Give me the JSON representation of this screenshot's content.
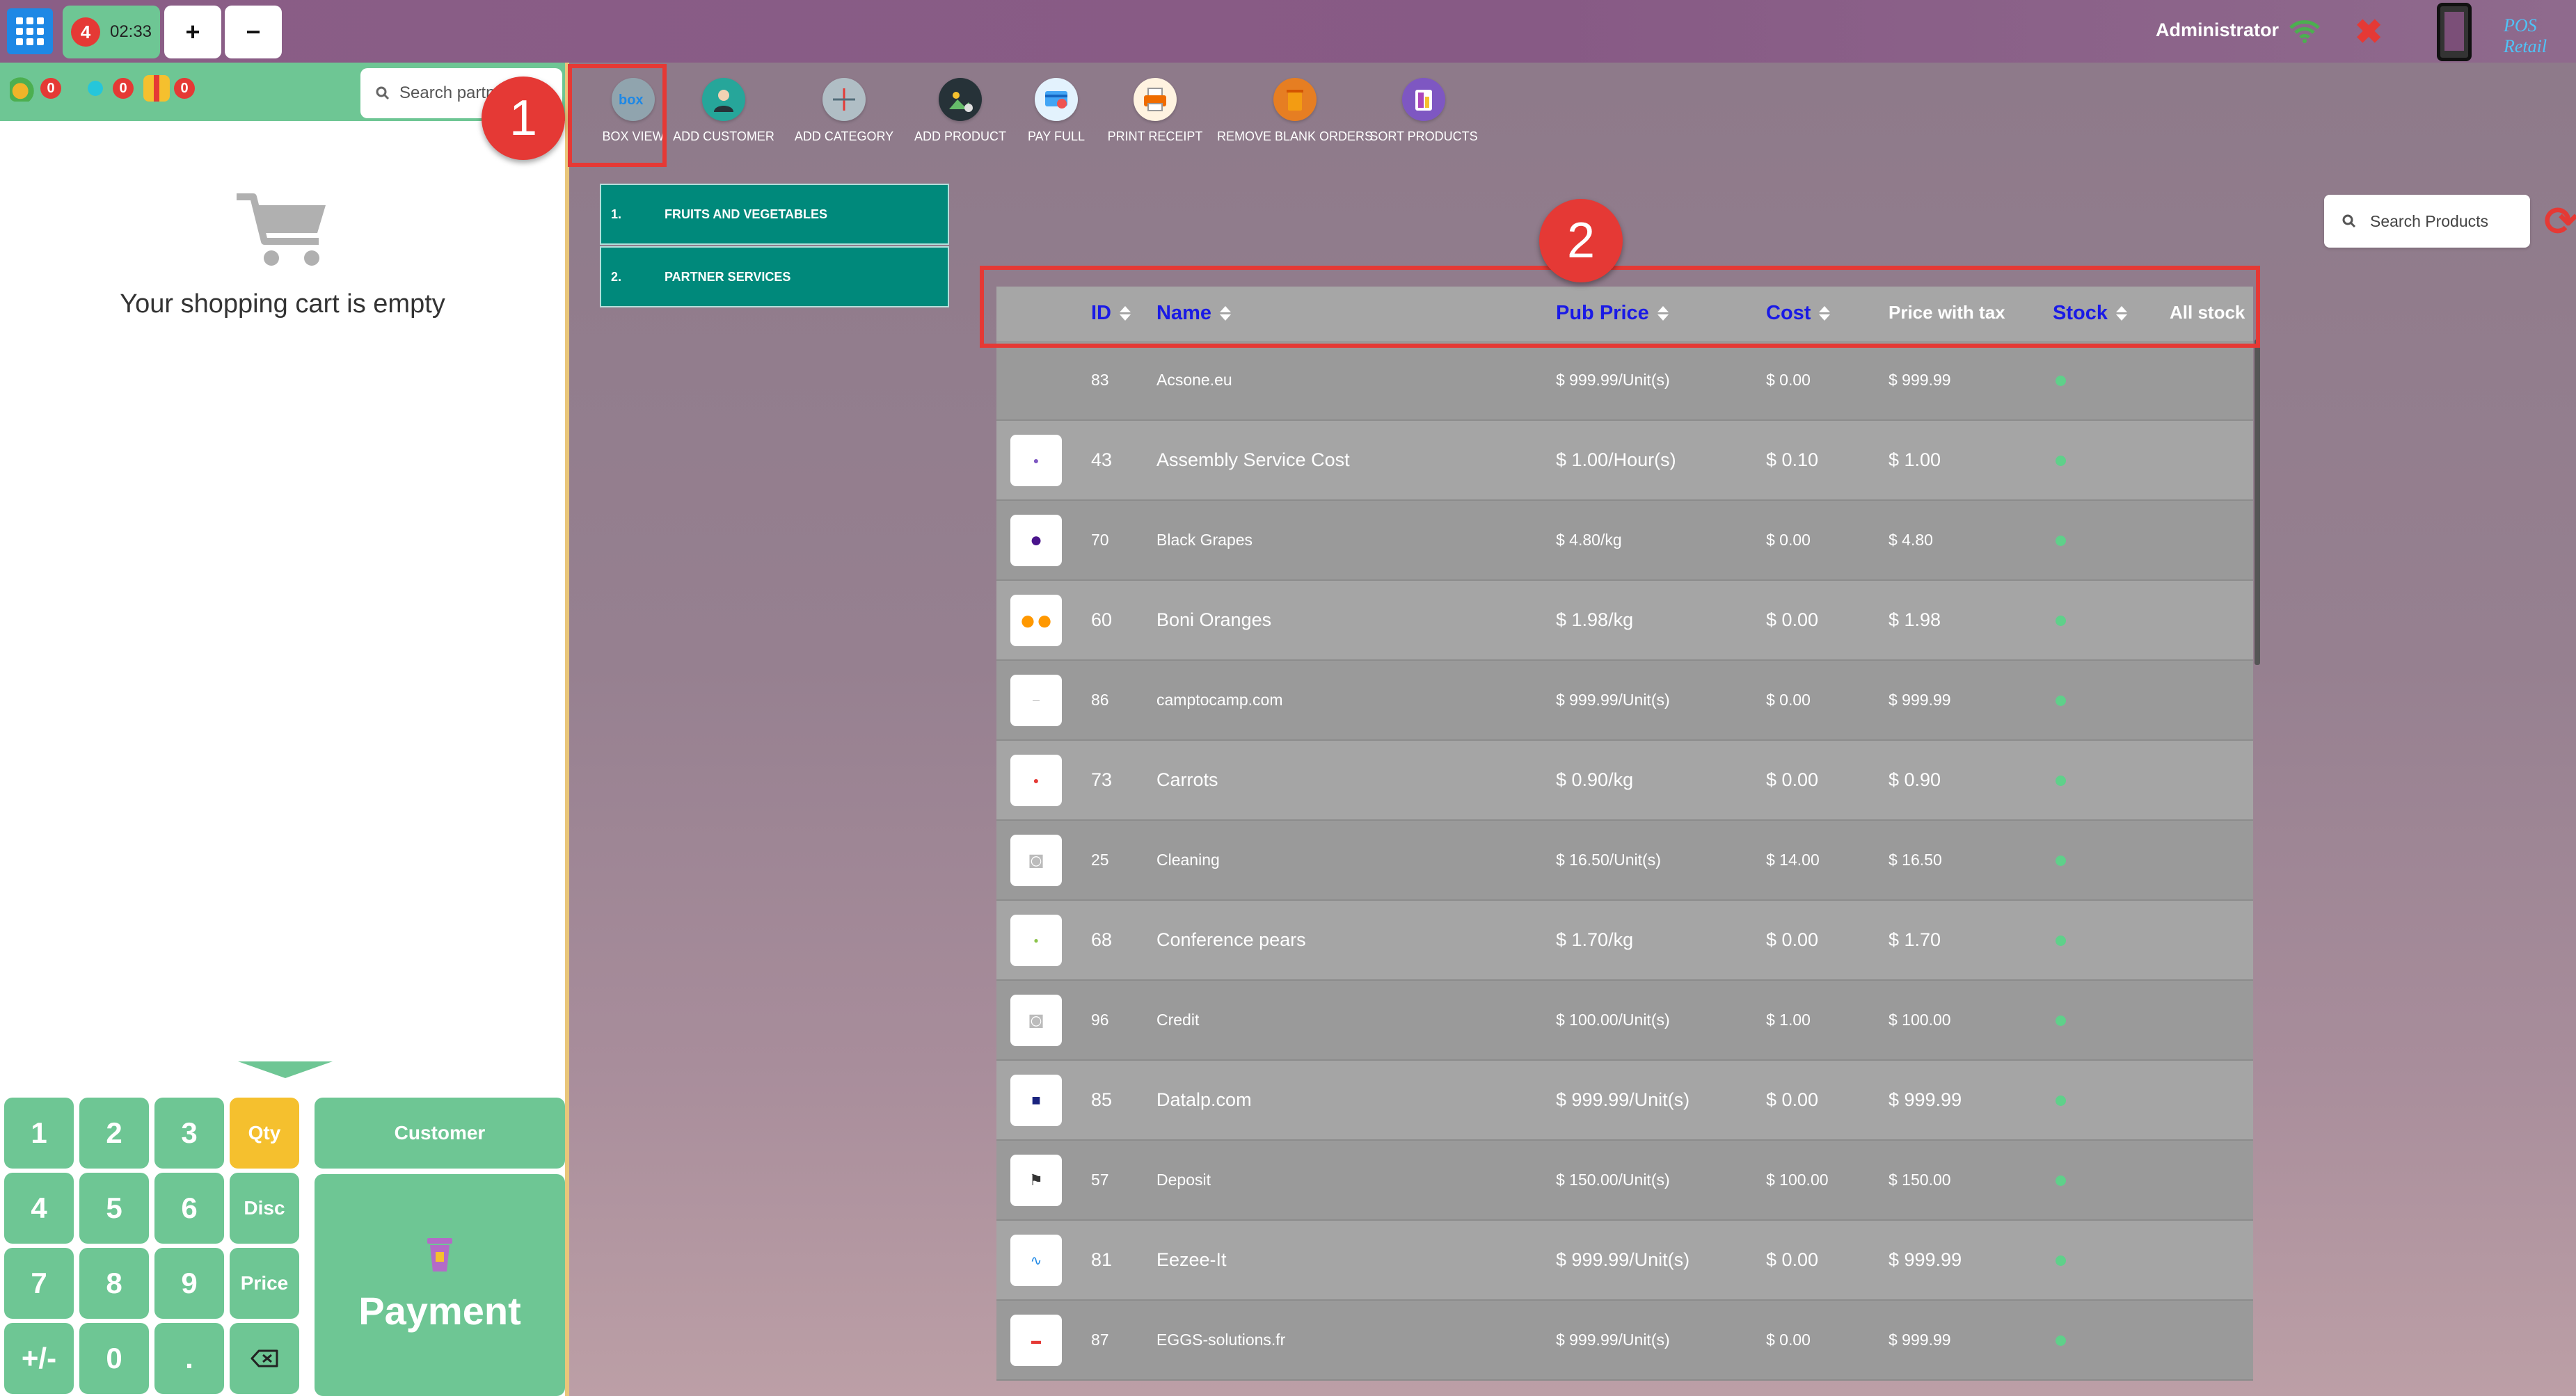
{
  "topbar": {
    "order_number": "4",
    "order_time": "02:33",
    "add_label": "+",
    "remove_label": "−",
    "user_name": "Administrator",
    "brand": "POS Retail"
  },
  "left": {
    "stats": [
      "0",
      "0",
      "0"
    ],
    "partner_search_placeholder": "Search partners",
    "cart_empty_text": "Your shopping cart is empty",
    "numpad": {
      "k1": "1",
      "k2": "2",
      "k3": "3",
      "k4": "4",
      "k5": "5",
      "k6": "6",
      "k7": "7",
      "k8": "8",
      "k9": "9",
      "k0": "0",
      "plusminus": "+/-",
      "dot": ".",
      "qty": "Qty",
      "disc": "Disc",
      "price": "Price"
    },
    "customer_label": "Customer",
    "payment_label": "Payment"
  },
  "toolbar": {
    "box_view": "BOX VIEW",
    "add_customer": "ADD CUSTOMER",
    "add_category": "ADD CATEGORY",
    "add_product": "ADD PRODUCT",
    "pay_full": "PAY FULL",
    "print_receipt": "PRINT RECEIPT",
    "remove_blank_orders": "REMOVE BLANK ORDERS",
    "sort_products": "SORT PRODUCTS"
  },
  "callouts": {
    "one": "1",
    "two": "2"
  },
  "categories": [
    {
      "index": "1.",
      "name": "FRUITS AND VEGETABLES"
    },
    {
      "index": "2.",
      "name": "PARTNER SERVICES"
    }
  ],
  "product_search_placeholder": "Search Products",
  "table": {
    "headers": {
      "id": "ID",
      "name": "Name",
      "pub_price": "Pub Price",
      "cost": "Cost",
      "price_with_tax": "Price with tax",
      "stock": "Stock",
      "all_stock": "All stock"
    },
    "rows": [
      {
        "id": "83",
        "name": "Acsone.eu",
        "pub_price": "$ 999.99/Unit(s)",
        "cost": "$ 0.00",
        "price_tax": "$ 999.99"
      },
      {
        "id": "43",
        "name": "Assembly Service Cost",
        "pub_price": "$ 1.00/Hour(s)",
        "cost": "$ 0.10",
        "price_tax": "$ 1.00"
      },
      {
        "id": "70",
        "name": "Black Grapes",
        "pub_price": "$ 4.80/kg",
        "cost": "$ 0.00",
        "price_tax": "$ 4.80"
      },
      {
        "id": "60",
        "name": "Boni Oranges",
        "pub_price": "$ 1.98/kg",
        "cost": "$ 0.00",
        "price_tax": "$ 1.98"
      },
      {
        "id": "86",
        "name": "camptocamp.com",
        "pub_price": "$ 999.99/Unit(s)",
        "cost": "$ 0.00",
        "price_tax": "$ 999.99"
      },
      {
        "id": "73",
        "name": "Carrots",
        "pub_price": "$ 0.90/kg",
        "cost": "$ 0.00",
        "price_tax": "$ 0.90"
      },
      {
        "id": "25",
        "name": "Cleaning",
        "pub_price": "$ 16.50/Unit(s)",
        "cost": "$ 14.00",
        "price_tax": "$ 16.50"
      },
      {
        "id": "68",
        "name": "Conference pears",
        "pub_price": "$ 1.70/kg",
        "cost": "$ 0.00",
        "price_tax": "$ 1.70"
      },
      {
        "id": "96",
        "name": "Credit",
        "pub_price": "$ 100.00/Unit(s)",
        "cost": "$ 1.00",
        "price_tax": "$ 100.00"
      },
      {
        "id": "85",
        "name": "Datalp.com",
        "pub_price": "$ 999.99/Unit(s)",
        "cost": "$ 0.00",
        "price_tax": "$ 999.99"
      },
      {
        "id": "57",
        "name": "Deposit",
        "pub_price": "$ 150.00/Unit(s)",
        "cost": "$ 100.00",
        "price_tax": "$ 150.00"
      },
      {
        "id": "81",
        "name": "Eezee-It",
        "pub_price": "$ 999.99/Unit(s)",
        "cost": "$ 0.00",
        "price_tax": "$ 999.99"
      },
      {
        "id": "87",
        "name": "EGGS-solutions.fr",
        "pub_price": "$ 999.99/Unit(s)",
        "cost": "$ 0.00",
        "price_tax": "$ 999.99"
      }
    ]
  },
  "colors": {
    "accent_green": "#6ec694",
    "category_teal": "#00897b",
    "header_purple": "#875a85",
    "highlight_red": "#e53935",
    "qty_active": "#f5c02e",
    "header_text_blue": "#1a1ae6"
  }
}
